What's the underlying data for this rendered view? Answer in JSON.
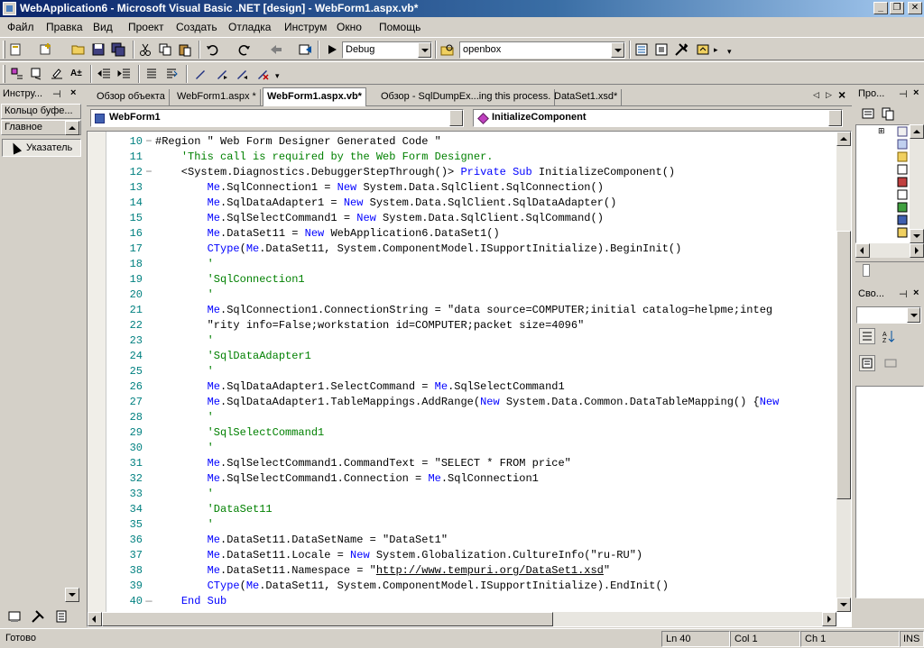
{
  "window": {
    "title": "WebApplication6 - Microsoft Visual Basic .NET [design] - WebForm1.aspx.vb*"
  },
  "menu": [
    "Файл",
    "Правка",
    "Вид",
    "Проект",
    "Создать",
    "Отладка",
    "Инструм",
    "Окно",
    "Помощь"
  ],
  "toolbar": {
    "config": "Debug",
    "find": "openbox"
  },
  "toolbox": {
    "title": "Инстру...",
    "sections": [
      "Кольцо буфе...",
      "Главное"
    ],
    "pointer": "Указатель"
  },
  "tabs": [
    "Обзор объекта",
    "WebForm1.aspx *",
    "WebForm1.aspx.vb*",
    "Обзор - SqlDumpEx...ing this process.",
    "DataSet1.xsd*"
  ],
  "editor": {
    "class_combo": "WebForm1",
    "method_combo": "InitializeComponent",
    "lines": [
      {
        "n": "10",
        "f": "−",
        "parts": [
          {
            "t": "#Region \" Web Form Designer Generated Code \"",
            "c": ""
          }
        ]
      },
      {
        "n": "11",
        "f": "",
        "parts": [
          {
            "t": "    ",
            "c": ""
          },
          {
            "t": "'This call is required by the Web Form Designer.",
            "c": "cm"
          }
        ]
      },
      {
        "n": "12",
        "f": "−",
        "parts": [
          {
            "t": "    <System.Diagnostics.DebuggerStepThrough()> ",
            "c": ""
          },
          {
            "t": "Private Sub",
            "c": "kw"
          },
          {
            "t": " InitializeComponent()",
            "c": ""
          }
        ]
      },
      {
        "n": "13",
        "f": "",
        "parts": [
          {
            "t": "        ",
            "c": ""
          },
          {
            "t": "Me",
            "c": "kw"
          },
          {
            "t": ".SqlConnection1 = ",
            "c": ""
          },
          {
            "t": "New",
            "c": "kw"
          },
          {
            "t": " System.Data.SqlClient.SqlConnection()",
            "c": ""
          }
        ]
      },
      {
        "n": "14",
        "f": "",
        "parts": [
          {
            "t": "        ",
            "c": ""
          },
          {
            "t": "Me",
            "c": "kw"
          },
          {
            "t": ".SqlDataAdapter1 = ",
            "c": ""
          },
          {
            "t": "New",
            "c": "kw"
          },
          {
            "t": " System.Data.SqlClient.SqlDataAdapter()",
            "c": ""
          }
        ]
      },
      {
        "n": "15",
        "f": "",
        "parts": [
          {
            "t": "        ",
            "c": ""
          },
          {
            "t": "Me",
            "c": "kw"
          },
          {
            "t": ".SqlSelectCommand1 = ",
            "c": ""
          },
          {
            "t": "New",
            "c": "kw"
          },
          {
            "t": " System.Data.SqlClient.SqlCommand()",
            "c": ""
          }
        ]
      },
      {
        "n": "16",
        "f": "",
        "parts": [
          {
            "t": "        ",
            "c": ""
          },
          {
            "t": "Me",
            "c": "kw"
          },
          {
            "t": ".DataSet11 = ",
            "c": ""
          },
          {
            "t": "New",
            "c": "kw"
          },
          {
            "t": " WebApplication6.DataSet1()",
            "c": ""
          }
        ]
      },
      {
        "n": "17",
        "f": "",
        "parts": [
          {
            "t": "        ",
            "c": ""
          },
          {
            "t": "CType",
            "c": "kw"
          },
          {
            "t": "(",
            "c": ""
          },
          {
            "t": "Me",
            "c": "kw"
          },
          {
            "t": ".DataSet11, System.ComponentModel.ISupportInitialize).BeginInit()",
            "c": ""
          }
        ]
      },
      {
        "n": "18",
        "f": "",
        "parts": [
          {
            "t": "        ",
            "c": ""
          },
          {
            "t": "'",
            "c": "cm"
          }
        ]
      },
      {
        "n": "19",
        "f": "",
        "parts": [
          {
            "t": "        ",
            "c": ""
          },
          {
            "t": "'SqlConnection1",
            "c": "cm"
          }
        ]
      },
      {
        "n": "20",
        "f": "",
        "parts": [
          {
            "t": "        ",
            "c": ""
          },
          {
            "t": "'",
            "c": "cm"
          }
        ]
      },
      {
        "n": "21",
        "f": "",
        "parts": [
          {
            "t": "        ",
            "c": ""
          },
          {
            "t": "Me",
            "c": "kw"
          },
          {
            "t": ".SqlConnection1.ConnectionString = \"data source=COMPUTER;initial catalog=helpme;integ",
            "c": ""
          }
        ]
      },
      {
        "n": "22",
        "f": "",
        "parts": [
          {
            "t": "        \"rity info=False;workstation id=COMPUTER;packet size=4096\"",
            "c": ""
          }
        ]
      },
      {
        "n": "23",
        "f": "",
        "parts": [
          {
            "t": "        ",
            "c": ""
          },
          {
            "t": "'",
            "c": "cm"
          }
        ]
      },
      {
        "n": "24",
        "f": "",
        "parts": [
          {
            "t": "        ",
            "c": ""
          },
          {
            "t": "'SqlDataAdapter1",
            "c": "cm"
          }
        ]
      },
      {
        "n": "25",
        "f": "",
        "parts": [
          {
            "t": "        ",
            "c": ""
          },
          {
            "t": "'",
            "c": "cm"
          }
        ]
      },
      {
        "n": "26",
        "f": "",
        "parts": [
          {
            "t": "        ",
            "c": ""
          },
          {
            "t": "Me",
            "c": "kw"
          },
          {
            "t": ".SqlDataAdapter1.SelectCommand = ",
            "c": ""
          },
          {
            "t": "Me",
            "c": "kw"
          },
          {
            "t": ".SqlSelectCommand1",
            "c": ""
          }
        ]
      },
      {
        "n": "27",
        "f": "",
        "parts": [
          {
            "t": "        ",
            "c": ""
          },
          {
            "t": "Me",
            "c": "kw"
          },
          {
            "t": ".SqlDataAdapter1.TableMappings.AddRange(",
            "c": ""
          },
          {
            "t": "New",
            "c": "kw"
          },
          {
            "t": " System.Data.Common.DataTableMapping() {",
            "c": ""
          },
          {
            "t": "New",
            "c": "kw"
          }
        ]
      },
      {
        "n": "28",
        "f": "",
        "parts": [
          {
            "t": "        ",
            "c": ""
          },
          {
            "t": "'",
            "c": "cm"
          }
        ]
      },
      {
        "n": "29",
        "f": "",
        "parts": [
          {
            "t": "        ",
            "c": ""
          },
          {
            "t": "'SqlSelectCommand1",
            "c": "cm"
          }
        ]
      },
      {
        "n": "30",
        "f": "",
        "parts": [
          {
            "t": "        ",
            "c": ""
          },
          {
            "t": "'",
            "c": "cm"
          }
        ]
      },
      {
        "n": "31",
        "f": "",
        "parts": [
          {
            "t": "        ",
            "c": ""
          },
          {
            "t": "Me",
            "c": "kw"
          },
          {
            "t": ".SqlSelectCommand1.CommandText = \"SELECT * FROM price\"",
            "c": ""
          }
        ]
      },
      {
        "n": "32",
        "f": "",
        "parts": [
          {
            "t": "        ",
            "c": ""
          },
          {
            "t": "Me",
            "c": "kw"
          },
          {
            "t": ".SqlSelectCommand1.Connection = ",
            "c": ""
          },
          {
            "t": "Me",
            "c": "kw"
          },
          {
            "t": ".SqlConnection1",
            "c": ""
          }
        ]
      },
      {
        "n": "33",
        "f": "",
        "parts": [
          {
            "t": "        ",
            "c": ""
          },
          {
            "t": "'",
            "c": "cm"
          }
        ]
      },
      {
        "n": "34",
        "f": "",
        "parts": [
          {
            "t": "        ",
            "c": ""
          },
          {
            "t": "'DataSet11",
            "c": "cm"
          }
        ]
      },
      {
        "n": "35",
        "f": "",
        "parts": [
          {
            "t": "        ",
            "c": ""
          },
          {
            "t": "'",
            "c": "cm"
          }
        ]
      },
      {
        "n": "36",
        "f": "",
        "parts": [
          {
            "t": "        ",
            "c": ""
          },
          {
            "t": "Me",
            "c": "kw"
          },
          {
            "t": ".DataSet11.DataSetName = \"DataSet1\"",
            "c": ""
          }
        ]
      },
      {
        "n": "37",
        "f": "",
        "parts": [
          {
            "t": "        ",
            "c": ""
          },
          {
            "t": "Me",
            "c": "kw"
          },
          {
            "t": ".DataSet11.Locale = ",
            "c": ""
          },
          {
            "t": "New",
            "c": "kw"
          },
          {
            "t": " System.Globalization.CultureInfo(\"ru-RU\")",
            "c": ""
          }
        ]
      },
      {
        "n": "38",
        "f": "",
        "parts": [
          {
            "t": "        ",
            "c": ""
          },
          {
            "t": "Me",
            "c": "kw"
          },
          {
            "t": ".DataSet11.Namespace = \"",
            "c": ""
          },
          {
            "t": "http://www.tempuri.org/DataSet1.xsd",
            "c": "url"
          },
          {
            "t": "\"",
            "c": ""
          }
        ]
      },
      {
        "n": "39",
        "f": "",
        "parts": [
          {
            "t": "        ",
            "c": ""
          },
          {
            "t": "CType",
            "c": "kw"
          },
          {
            "t": "(",
            "c": ""
          },
          {
            "t": "Me",
            "c": "kw"
          },
          {
            "t": ".DataSet11, System.ComponentModel.ISupportInitialize).EndInit()",
            "c": ""
          }
        ]
      },
      {
        "n": "40",
        "f": "—",
        "parts": [
          {
            "t": "    ",
            "c": ""
          },
          {
            "t": "End Sub",
            "c": "kw"
          }
        ]
      }
    ]
  },
  "right_panels": {
    "solution_title": "Про...",
    "properties_title": "Сво..."
  },
  "status": {
    "text": "Готово",
    "line": "Ln 40",
    "col": "Col 1",
    "ch": "Ch 1",
    "ins": "INS"
  },
  "colors": {
    "keyword": "#0000ff",
    "comment": "#008000",
    "line_number": "#008080",
    "titlebar": "#0a246a"
  }
}
